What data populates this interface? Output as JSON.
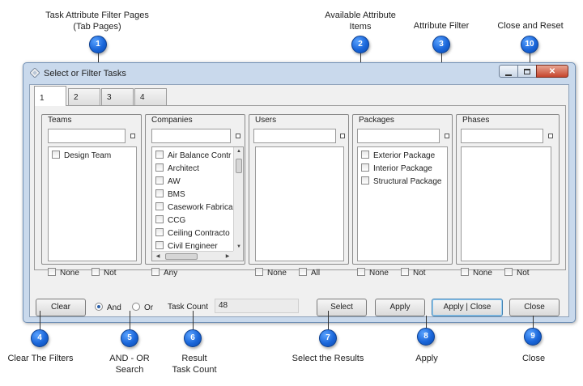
{
  "annotations": {
    "tab_pages": "Task Attribute Filter Pages\n(Tab Pages)",
    "available_items": "Available Attribute\nItems",
    "attribute_filter": "Attribute Filter",
    "close_reset": "Close and Reset",
    "clear_filters": "Clear The Filters",
    "and_or": "AND - OR\nSearch",
    "result_count": "Result\nTask Count",
    "select_results": "Select the Results",
    "apply": "Apply",
    "close": "Close"
  },
  "bubbles": [
    "1",
    "2",
    "3",
    "10",
    "4",
    "5",
    "6",
    "7",
    "8",
    "9"
  ],
  "window": {
    "title": "Select or Filter Tasks",
    "icon": "diamond-app-icon",
    "caption_buttons": {
      "minimize": "minimize-icon",
      "maximize": "maximize-icon",
      "close": "close-x-icon"
    }
  },
  "tabs": [
    "1",
    "2",
    "3",
    "4"
  ],
  "columns": {
    "teams": {
      "label": "Teams",
      "items": [
        "Design Team"
      ],
      "opt1": "None",
      "opt2": "Not"
    },
    "companies": {
      "label": "Companies",
      "items": [
        "Air Balance Contr",
        "Architect",
        "AW",
        "BMS",
        "Casework Fabrica",
        "CCG",
        "Ceiling Contracto",
        "Civil Engineer"
      ],
      "opt1": "Any"
    },
    "users": {
      "label": "Users",
      "items": [],
      "opt1": "None",
      "opt2": "All"
    },
    "packages": {
      "label": "Packages",
      "items": [
        "Exterior Package",
        "Interior Package",
        "Structural Package"
      ],
      "opt1": "None",
      "opt2": "Not"
    },
    "phases": {
      "label": "Phases",
      "items": [],
      "opt1": "None",
      "opt2": "Not"
    }
  },
  "bottom": {
    "clear": "Clear",
    "and": "And",
    "or": "Or",
    "task_count_label": "Task Count",
    "task_count_value": "48",
    "select": "Select",
    "apply": "Apply",
    "apply_close": "Apply | Close",
    "close": "Close"
  }
}
